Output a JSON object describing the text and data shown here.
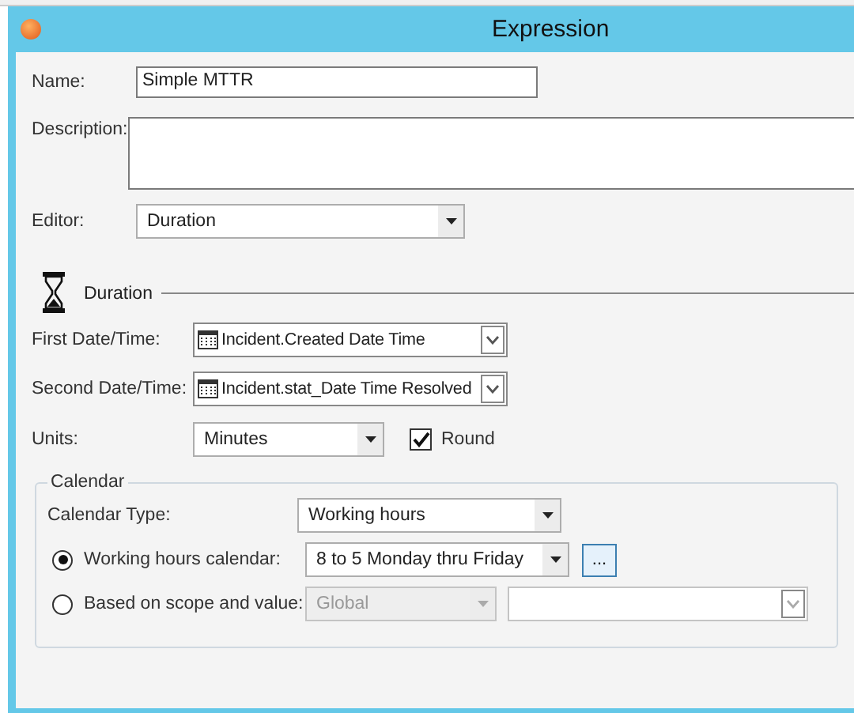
{
  "window": {
    "title": "Expression"
  },
  "name": {
    "label": "Name:",
    "value": "Simple MTTR"
  },
  "description": {
    "label": "Description:"
  },
  "editor": {
    "label": "Editor:",
    "value": "Duration"
  },
  "duration": {
    "title": "Duration",
    "first": {
      "label": "First Date/Time:",
      "value": "Incident.Created Date Time"
    },
    "second": {
      "label": "Second Date/Time:",
      "value": "Incident.stat_Date Time Resolved"
    },
    "units": {
      "label": "Units:",
      "value": "Minutes"
    },
    "round": {
      "label": "Round",
      "checked": true
    }
  },
  "calendar": {
    "title": "Calendar",
    "type": {
      "label": "Calendar Type:",
      "value": "Working hours"
    },
    "options": [
      {
        "kind": "calendar",
        "label": "Working hours calendar:",
        "selected": true,
        "value": "8 to 5 Monday thru Friday",
        "button": "...",
        "disabled": false
      },
      {
        "kind": "scope",
        "label": "Based on scope and value:",
        "selected": false,
        "scope": "Global",
        "disabled": true
      }
    ]
  }
}
